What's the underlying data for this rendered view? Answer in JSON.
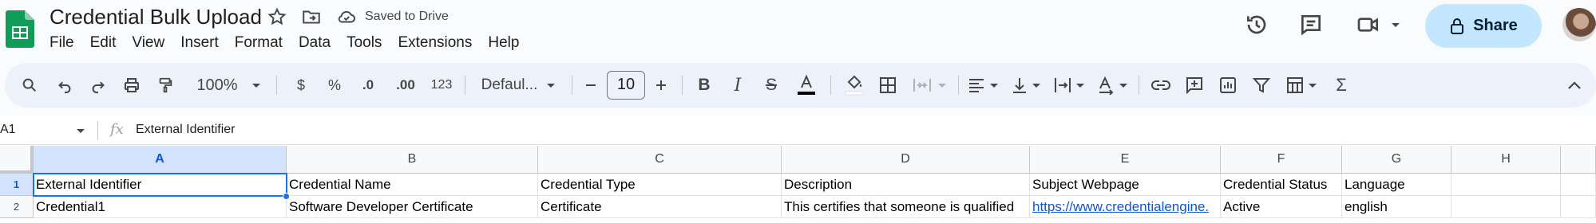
{
  "app": {
    "title": "Credential Bulk Upload",
    "saved_status": "Saved to Drive",
    "share_label": "Share",
    "accent_color": "#1a73e8"
  },
  "menu": [
    "File",
    "Edit",
    "View",
    "Insert",
    "Format",
    "Data",
    "Tools",
    "Extensions",
    "Help"
  ],
  "toolbar": {
    "zoom": "100%",
    "currency": "$",
    "percent": "%",
    "decrease_decimal": ".0",
    "increase_decimal": ".00",
    "number_format": "123",
    "font": "Defaul...",
    "font_size": "10",
    "icons": [
      "search-icon",
      "undo-icon",
      "redo-icon",
      "print-icon",
      "paint-format-icon",
      "bold-icon",
      "italic-icon",
      "strikethrough-icon",
      "text-color-icon",
      "fill-color-icon",
      "borders-icon",
      "merge-icon",
      "align-icon",
      "valign-icon",
      "wrap-icon",
      "rotate-icon",
      "link-icon",
      "comment-icon",
      "chart-icon",
      "filter-icon",
      "filter-views-icon",
      "functions-icon",
      "collapse-icon"
    ]
  },
  "formula_bar": {
    "cell_ref": "A1",
    "fx": "fx",
    "content": "External Identifier"
  },
  "sheet": {
    "columns": [
      "A",
      "B",
      "C",
      "D",
      "E",
      "F",
      "G",
      "H"
    ],
    "rows": [
      {
        "num": "1",
        "cells": [
          "External Identifier",
          "Credential Name",
          "Credential Type",
          "Description",
          "Subject Webpage",
          "Credential Status",
          "Language",
          ""
        ]
      },
      {
        "num": "2",
        "cells": [
          "Credential1",
          "Software Developer Certificate",
          "Certificate",
          "This certifies that someone is qualified",
          "https://www.credentialengine.",
          "Active",
          "english",
          ""
        ]
      }
    ]
  }
}
